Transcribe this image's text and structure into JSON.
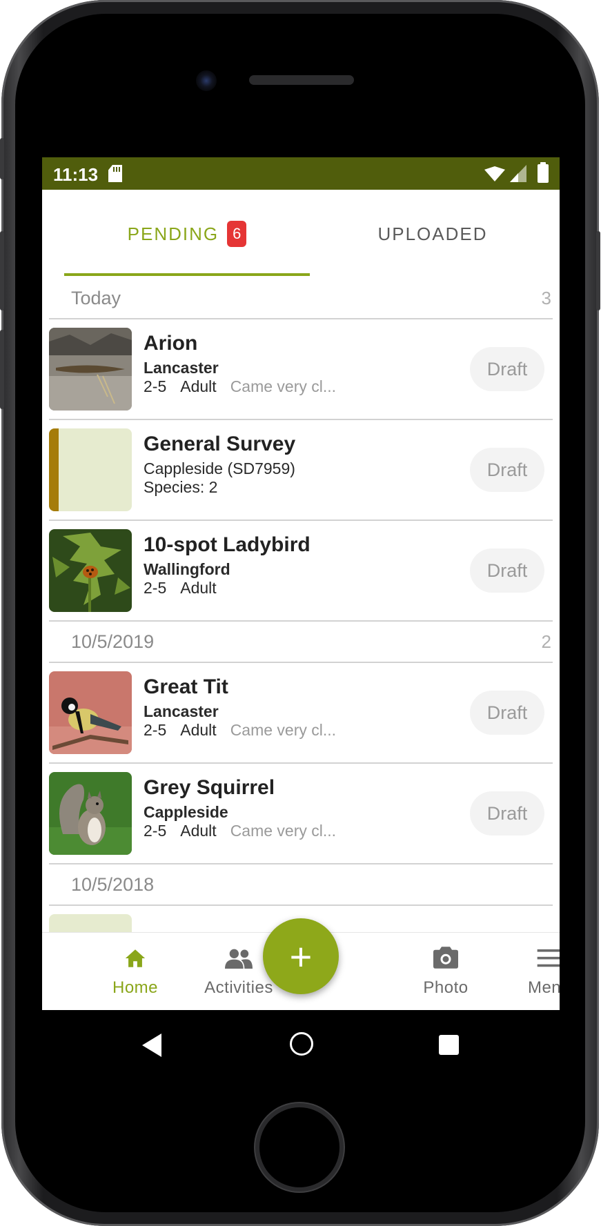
{
  "status_bar": {
    "time": "11:13"
  },
  "tabs": {
    "pending_label": "PENDING",
    "pending_count": "6",
    "uploaded_label": "UPLOADED"
  },
  "groups": [
    {
      "date": "Today",
      "count": "3",
      "items": [
        {
          "title": "Arion",
          "location": "Lancaster",
          "meta": [
            "2-5",
            "Adult"
          ],
          "comment": "Came very cl...",
          "status": "Draft"
        },
        {
          "title": "General Survey",
          "location": "Cappleside (SD7959)",
          "meta": [
            "Species: 2"
          ],
          "comment": "",
          "status": "Draft"
        },
        {
          "title": "10-spot Ladybird",
          "location": "Wallingford",
          "meta": [
            "2-5",
            "Adult"
          ],
          "comment": "",
          "status": "Draft"
        }
      ]
    },
    {
      "date": "10/5/2019",
      "count": "2",
      "items": [
        {
          "title": "Great Tit",
          "location": "Lancaster",
          "meta": [
            "2-5",
            "Adult"
          ],
          "comment": "Came very cl...",
          "status": "Draft"
        },
        {
          "title": "Grey Squirrel",
          "location": "Cappleside",
          "meta": [
            "2-5",
            "Adult"
          ],
          "comment": "Came very cl...",
          "status": "Draft"
        }
      ]
    },
    {
      "date": "10/5/2018",
      "count": "",
      "items": []
    }
  ],
  "footer": {
    "home_label": "Home",
    "activities_label": "Activities",
    "fab_label": "+",
    "photo_label": "Photo",
    "menu_label": "Menu"
  },
  "icons": {
    "home": "home-icon",
    "activities": "people-icon",
    "photo": "camera-icon",
    "menu": "hamburger-icon",
    "add": "plus-icon"
  },
  "colors": {
    "status_bar": "#505d0c",
    "accent": "#8aa61a",
    "badge": "#e53535",
    "survey_bar": "#a57c0a"
  }
}
